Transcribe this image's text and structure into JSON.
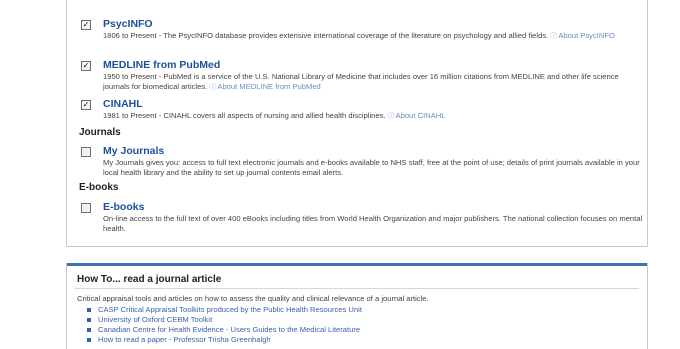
{
  "databases": [
    {
      "checked": true,
      "checkbox_glyph": "✓",
      "title": "PsycINFO",
      "description": "1806 to Present - The PsycINFO database provides extensive international coverage of the literature on psychology and allied fields.",
      "about_link": "About PsycINFO"
    },
    {
      "checked": true,
      "checkbox_glyph": "✓",
      "title": "MEDLINE from PubMed",
      "description": "1950 to Present - PubMed is a service of the U.S. National Library of Medicine that includes over 16 million citations from MEDLINE and other life science journals for biomedical articles.",
      "about_link": "About MEDLINE from PubMed"
    },
    {
      "checked": true,
      "checkbox_glyph": "✓",
      "title": "CINAHL",
      "description": "1981 to Present - CINAHL covers all aspects of nursing and allied health disciplines.",
      "about_link": "About CINAHL"
    }
  ],
  "journals_heading": "Journals",
  "journals": {
    "checked": false,
    "title": "My Journals",
    "description": "My Journals gives you: access to full text electronic journals and e-books available to NHS staff, free at the point of use; details of print journals available in your local health library and the ability to set up journal contents email alerts."
  },
  "ebooks_heading": "E-books",
  "ebooks": {
    "checked": false,
    "title": "E-books",
    "description": "On-line access to the full text of over 400 eBooks including titles from World Health Organization and major publishers. The national collection focuses on mental health."
  },
  "howto": {
    "heading": "How To... read a journal article",
    "intro": "Critical appraisal tools and articles on how to assess the quality and clinical relevance of a journal article.",
    "links": [
      "CASP Critical Appraisal Toolkits produced by the Public Health Resources Unit",
      "University of Oxford CEBM Toolkit",
      "Canadian Centre for Health Evidence - Users Guides to the Medical Literature",
      "How to read a paper - Professor Trisha Greenhalgh"
    ]
  },
  "colors": {
    "link": "#1f4f9c",
    "accent_bar": "#3b6fb6"
  }
}
